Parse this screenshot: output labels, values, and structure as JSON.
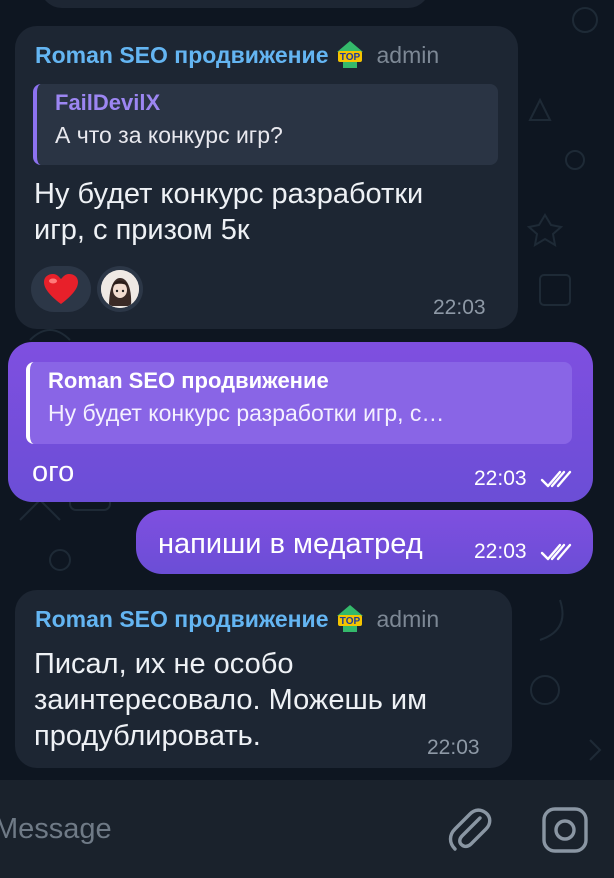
{
  "messages": [
    {
      "sender": "Roman SEO продвижение",
      "sender_badge": "top-badge-icon",
      "role": "admin",
      "reply_to": {
        "name": "FailDevilX",
        "text": "А что за конкурс игр?"
      },
      "text_lines": [
        "Ну будет конкурс разработки",
        "игр, с призом 5к"
      ],
      "reactions": [
        "heart-emoji",
        "user-avatar"
      ],
      "time": "22:03"
    },
    {
      "outgoing": true,
      "reply_to": {
        "name": "Roman SEO продвижение",
        "text": "Ну будет конкурс разработки игр, с…"
      },
      "text": "ого",
      "time": "22:03",
      "status": "double-check-icon"
    },
    {
      "outgoing": true,
      "text": "напиши в медатред",
      "time": "22:03",
      "status": "double-check-icon"
    },
    {
      "sender": "Roman SEO продвижение",
      "sender_badge": "top-badge-icon",
      "role": "admin",
      "text_lines": [
        "Писал, их не особо",
        "заинтересовало. Можешь им",
        "продублировать."
      ],
      "time": "22:03"
    }
  ],
  "composer": {
    "placeholder": "Message",
    "attach_icon": "paperclip-icon",
    "camera_icon": "camera-icon"
  },
  "colors": {
    "background": "#0e1621",
    "incoming_bubble": "#1d2633",
    "outgoing_bubble": "#7450dc",
    "sender_name": "#64b5f2",
    "reply_name_incoming": "#9c86f2"
  }
}
